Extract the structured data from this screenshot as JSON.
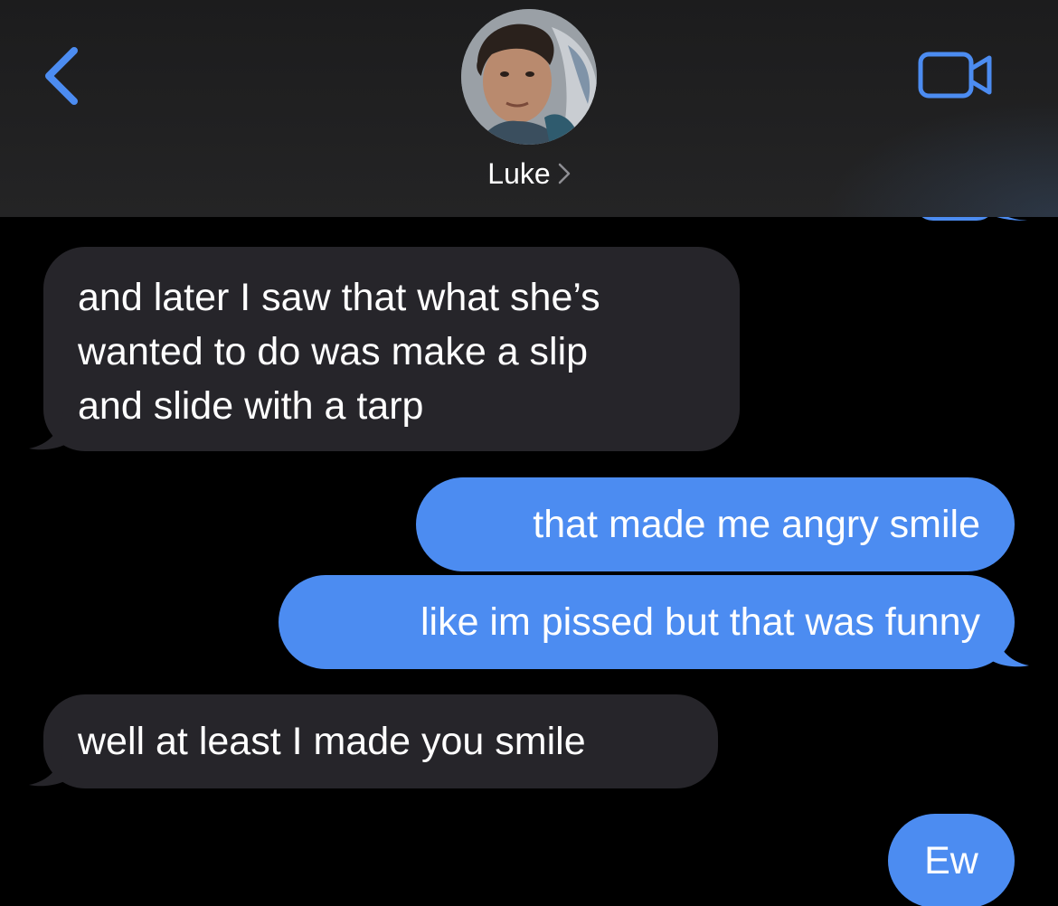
{
  "header": {
    "contact_name": "Luke",
    "icons": {
      "back": "chevron-left-icon",
      "video": "video-camera-icon",
      "name_chevron": "chevron-right-icon"
    },
    "accent_color": "#4c8cf1"
  },
  "conversation": {
    "colors": {
      "incoming_bubble": "#26252a",
      "outgoing_bubble": "#4c8cf1",
      "background": "#000000",
      "text": "#ffffff"
    },
    "messages": [
      {
        "direction": "incoming",
        "lines": [
          "and later I saw that what she’s",
          "wanted to do was make a slip",
          "and slide with a tarp"
        ]
      },
      {
        "direction": "outgoing",
        "text": "that made me angry smile"
      },
      {
        "direction": "outgoing",
        "text": "like im pissed but that was funny"
      },
      {
        "direction": "incoming",
        "text": "well at least I made you smile"
      },
      {
        "direction": "outgoing",
        "text": "Ew"
      }
    ]
  }
}
